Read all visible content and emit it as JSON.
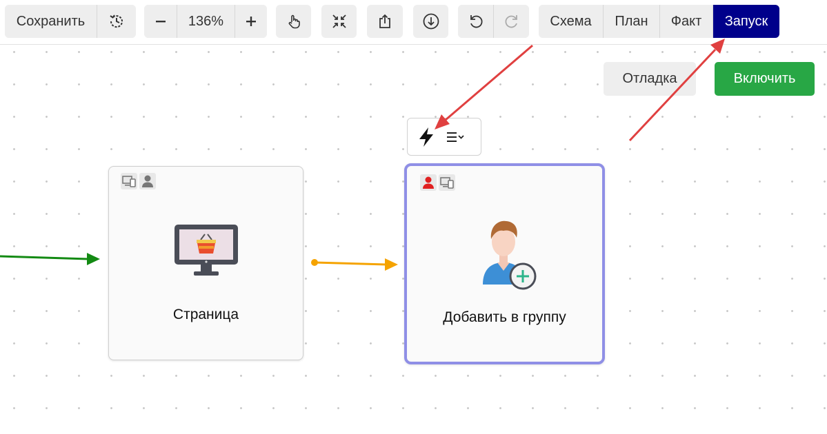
{
  "toolbar": {
    "save_label": "Сохранить",
    "zoom_label": "136%",
    "tabs": [
      {
        "label": "Схема"
      },
      {
        "label": "План"
      },
      {
        "label": "Факт"
      },
      {
        "label": "Запуск",
        "active": true
      }
    ]
  },
  "actions": {
    "debug_label": "Отладка",
    "enable_label": "Включить"
  },
  "nodes": [
    {
      "label": "Страница",
      "icon": "monitor-basket-icon",
      "badges": [
        "devices-icon",
        "user-icon"
      ]
    },
    {
      "label": "Добавить в группу",
      "icon": "user-add-icon",
      "badges": [
        "user-icon-red",
        "devices-icon"
      ],
      "selected": true
    }
  ],
  "colors": {
    "accent_tab": "#00008b",
    "enable_button": "#28a745",
    "selection_border": "#8f8fe6",
    "incoming_edge": "#138a13",
    "connection_edge": "#f5a300",
    "annotation_arrow": "#e04040"
  }
}
